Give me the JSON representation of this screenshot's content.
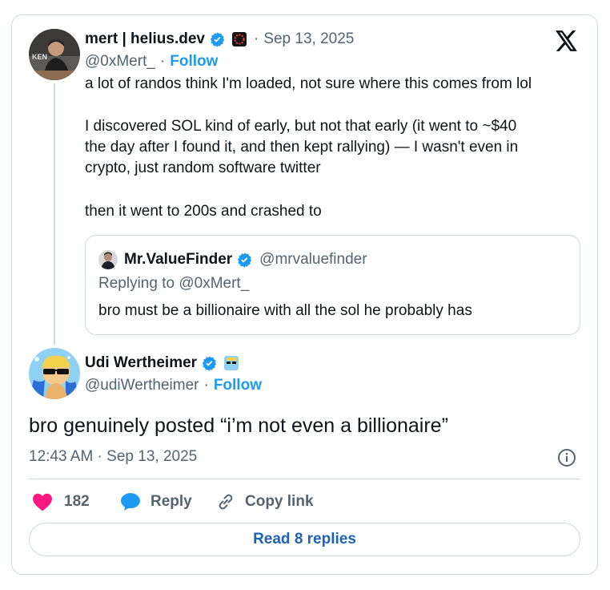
{
  "main_tweet": {
    "author_name": "mert | helius.dev",
    "separator": "·",
    "date": "Sep 13, 2025",
    "handle": "@0xMert_",
    "follow_sep": "·",
    "follow_label": "Follow",
    "lines": [
      "a lot of randos think I'm loaded, not sure where this comes from lol",
      "I discovered SOL kind of early, but not that early (it went to ~$40",
      "the day after I found it, and then kept rallying) — I wasn't even in",
      "crypto, just random software twitter",
      "then it went to 200s and crashed to"
    ]
  },
  "quoted_tweet": {
    "author_name": "Mr.ValueFinder",
    "handle": "@mrvaluefinder",
    "replying_to": "Replying to @0xMert_",
    "text": "bro must be a billionaire with all the sol he probably has"
  },
  "reply_tweet": {
    "author_name": "Udi Wertheimer",
    "handle": "@udiWertheimer",
    "follow_sep": "·",
    "follow_label": "Follow",
    "text": "bro genuinely posted “i’m not even a billionaire”",
    "timestamp": "12:43 AM · Sep 13, 2025"
  },
  "actions": {
    "like_count": "182",
    "reply_label": "Reply",
    "copy_label": "Copy link"
  },
  "footer": {
    "read_replies_label": "Read 8 replies"
  },
  "colors": {
    "accent": "#1d9bf0",
    "like": "#f91880",
    "verified": "#1d9bf0",
    "border": "#cfd9de",
    "muted": "#536471"
  },
  "icons": [
    "x-logo-icon",
    "verified-badge-icon",
    "heart-icon",
    "reply-bubble-icon",
    "link-icon",
    "info-icon"
  ]
}
